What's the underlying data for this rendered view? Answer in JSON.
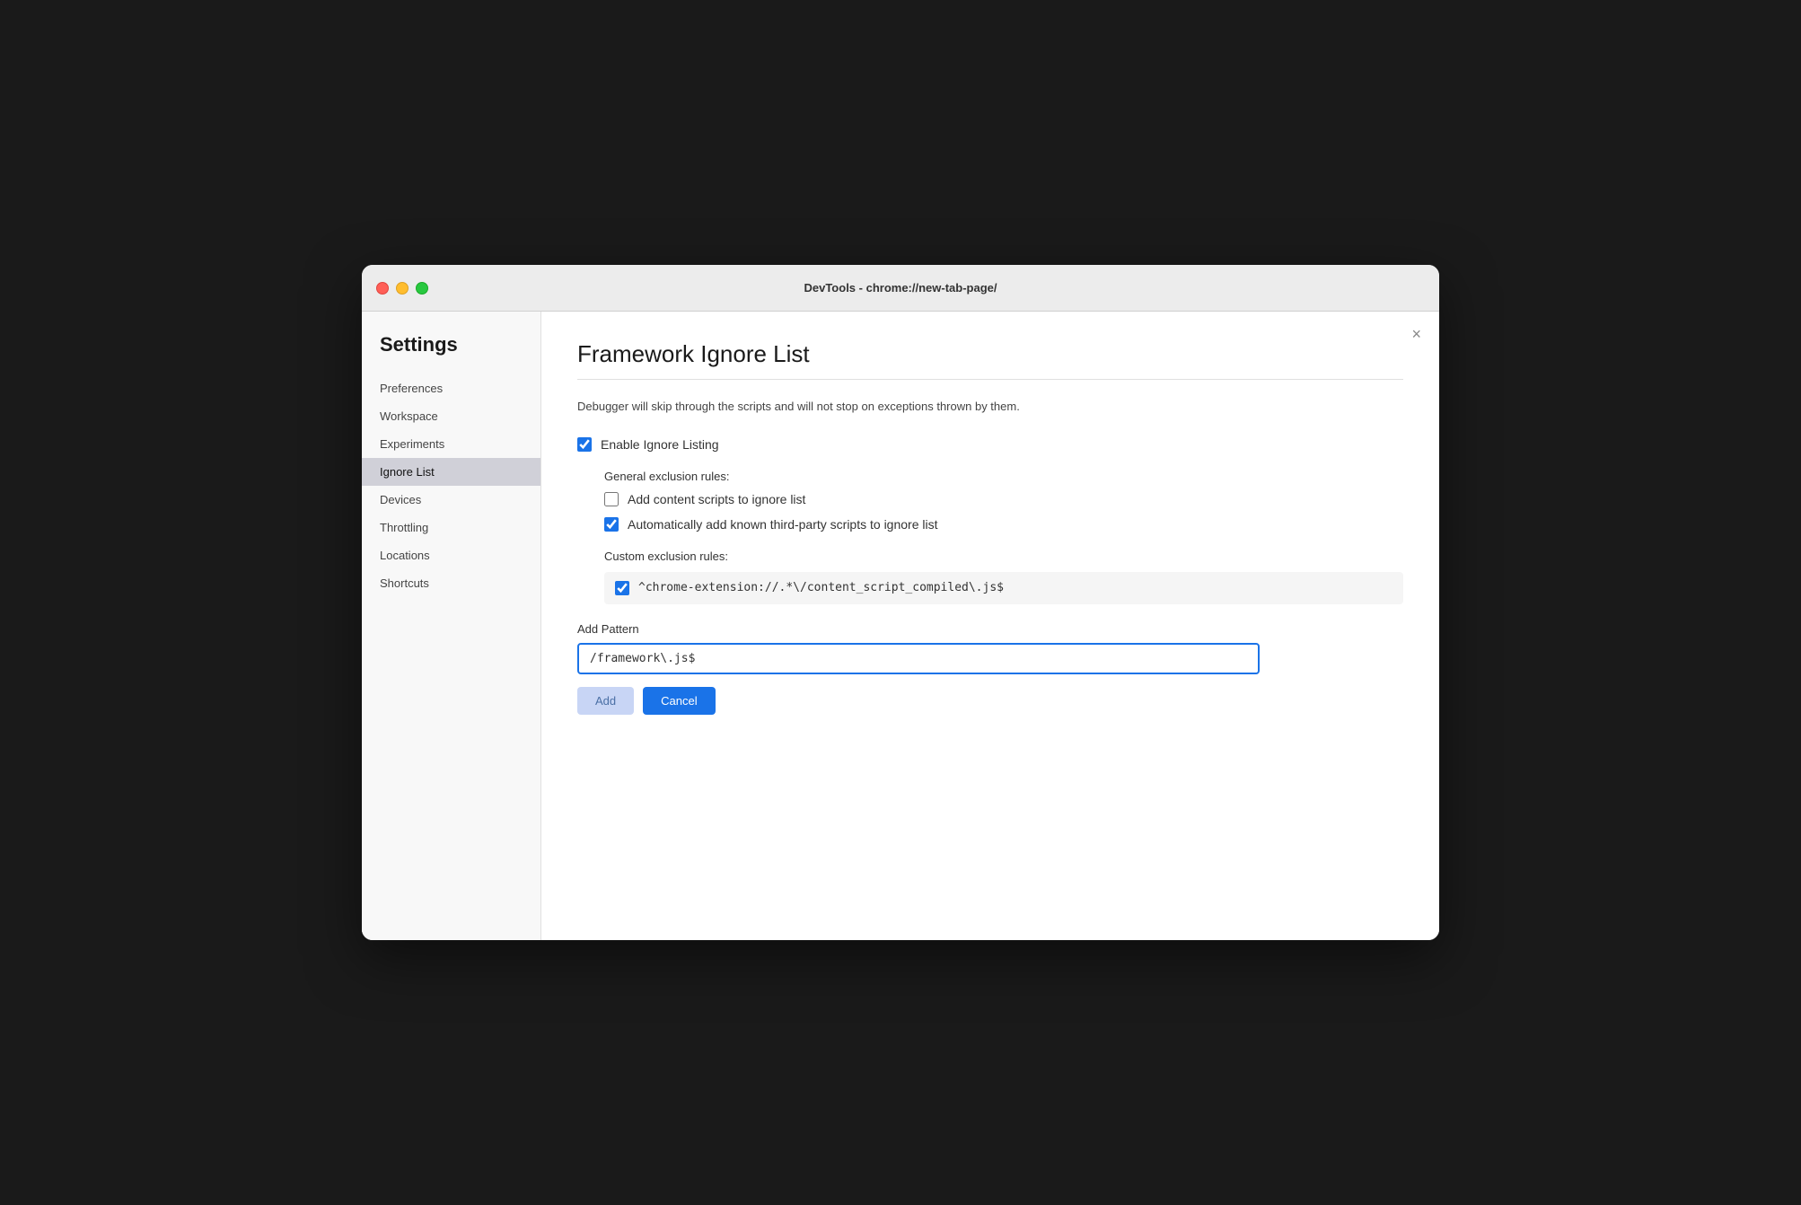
{
  "window": {
    "title": "DevTools - chrome://new-tab-page/"
  },
  "sidebar": {
    "heading": "Settings",
    "items": [
      {
        "id": "preferences",
        "label": "Preferences",
        "active": false
      },
      {
        "id": "workspace",
        "label": "Workspace",
        "active": false
      },
      {
        "id": "experiments",
        "label": "Experiments",
        "active": false
      },
      {
        "id": "ignore-list",
        "label": "Ignore List",
        "active": true
      },
      {
        "id": "devices",
        "label": "Devices",
        "active": false
      },
      {
        "id": "throttling",
        "label": "Throttling",
        "active": false
      },
      {
        "id": "locations",
        "label": "Locations",
        "active": false
      },
      {
        "id": "shortcuts",
        "label": "Shortcuts",
        "active": false
      }
    ]
  },
  "main": {
    "title": "Framework Ignore List",
    "description": "Debugger will skip through the scripts and will not stop on exceptions thrown by them.",
    "enable_ignore_listing": {
      "label": "Enable Ignore Listing",
      "checked": true
    },
    "general_exclusion": {
      "label": "General exclusion rules:",
      "rules": [
        {
          "id": "add-content-scripts",
          "label": "Add content scripts to ignore list",
          "checked": false
        },
        {
          "id": "auto-add-third-party",
          "label": "Automatically add known third-party scripts to ignore list",
          "checked": true
        }
      ]
    },
    "custom_exclusion": {
      "label": "Custom exclusion rules:",
      "rules": [
        {
          "id": "chrome-extension-rule",
          "label": "^chrome-extension://.*\\/content_script_compiled\\.js$",
          "checked": true
        }
      ]
    },
    "add_pattern": {
      "label": "Add Pattern",
      "placeholder": "/framework\\.js$",
      "value": "/framework\\.js$"
    },
    "buttons": {
      "add": "Add",
      "cancel": "Cancel"
    },
    "close_button": "×"
  }
}
